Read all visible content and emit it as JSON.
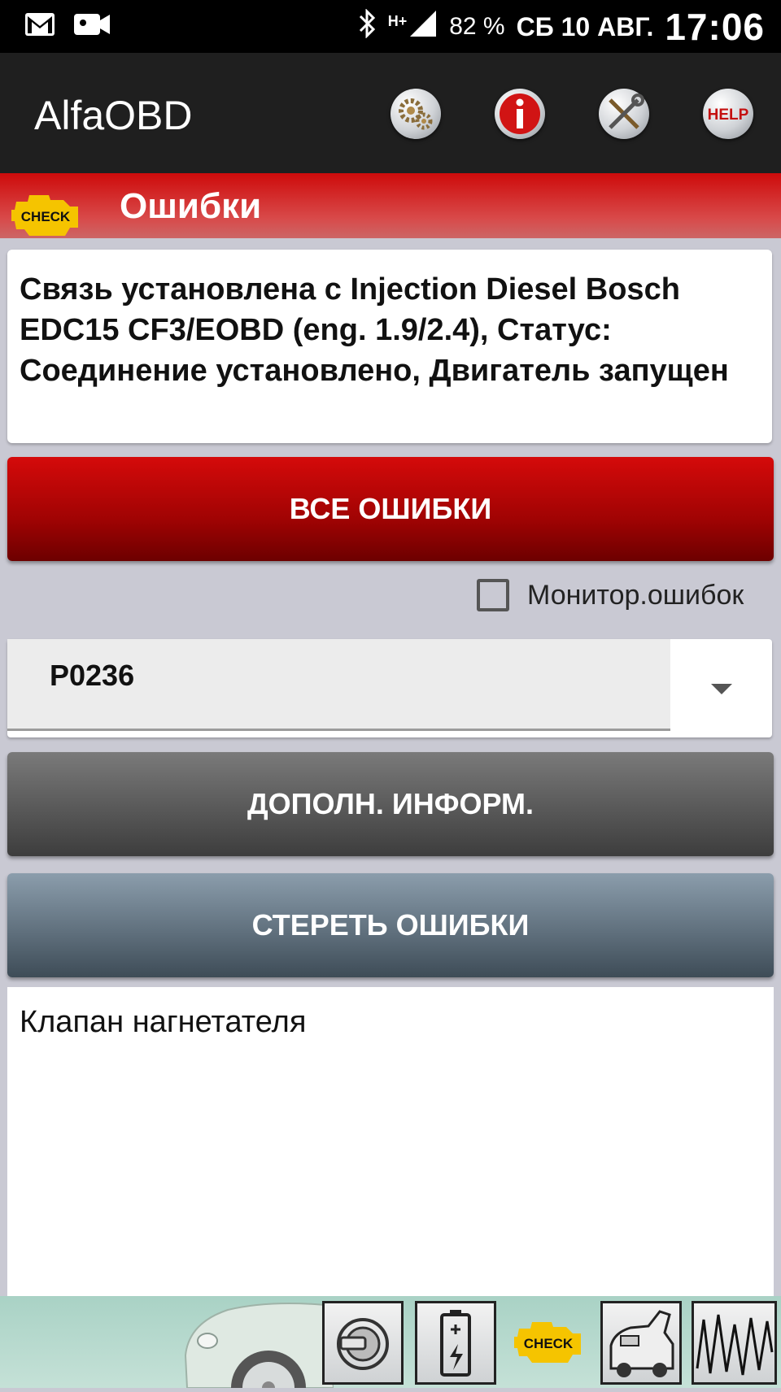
{
  "status_bar": {
    "network": "H+",
    "battery": "82 %",
    "date": "СБ 10 АВГ.",
    "time": "17:06",
    "icons": [
      "gmail-icon",
      "video-icon",
      "bluetooth-icon",
      "signal-icon"
    ]
  },
  "app_bar": {
    "title": "AlfaOBD",
    "actions": [
      {
        "name": "settings-gears-icon"
      },
      {
        "name": "info-icon",
        "glyph": "i"
      },
      {
        "name": "tools-icon"
      },
      {
        "name": "help-icon",
        "label": "HELP"
      }
    ]
  },
  "section": {
    "title": "Ошибки",
    "badge": "CHECK"
  },
  "connection_status": " Связь установлена с Injection Diesel Bosch EDC15 CF3/EOBD (eng. 1.9/2.4), Статус: Соединение установлено, Двигатель запущен",
  "buttons": {
    "all_errors": "ВСЕ ОШИБКИ",
    "more_info": "ДОПОЛН. ИНФОРМ.",
    "clear_errors": "СТЕРЕТЬ ОШИБКИ"
  },
  "monitor": {
    "label": "Монитор.ошибок",
    "checked": false
  },
  "error_select": {
    "value": "P0236"
  },
  "error_description": "Клапан нагнетателя",
  "bottom_nav": {
    "check_label": "CHECK",
    "items": [
      "car-image",
      "ignition-key-icon",
      "battery-icon",
      "check-engine-icon",
      "car-hood-open-icon",
      "waveform-icon"
    ]
  },
  "colors": {
    "accent_red": "#c80a0a",
    "check_yellow": "#f5c400",
    "app_bar": "#1f1f1f"
  }
}
